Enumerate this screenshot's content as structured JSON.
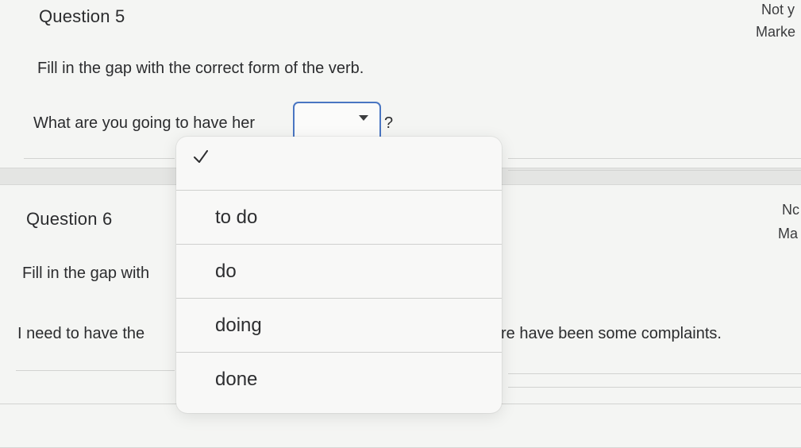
{
  "question5": {
    "title": "Question 5",
    "status_line1": "Not y",
    "status_line2": "Marke",
    "instruction": "Fill in the gap with the correct form of the verb.",
    "sentence_before": "What are you going to have her",
    "sentence_after": "?",
    "selected_value": ""
  },
  "question6": {
    "title": "Question 6",
    "status_line1": "Nc",
    "status_line2": "Ma",
    "instruction_visible": "Fill in the gap with",
    "sentence_before": "I need to have the",
    "sentence_after": "re have been some complaints."
  },
  "dropdown": {
    "options": [
      {
        "label": "",
        "checked": true
      },
      {
        "label": "to do",
        "checked": false
      },
      {
        "label": "do",
        "checked": false
      },
      {
        "label": "doing",
        "checked": false
      },
      {
        "label": "done",
        "checked": false
      }
    ]
  },
  "colors": {
    "focus_border": "#4a76c2",
    "card_background": "#f4f5f3",
    "page_background": "#e4e5e3"
  }
}
